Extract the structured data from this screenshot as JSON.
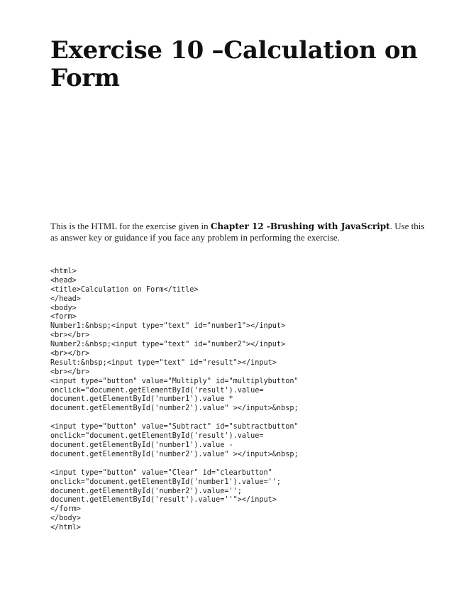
{
  "document": {
    "title": "Exercise 10 –Calculation on Form",
    "intro": {
      "before": "This is the HTML for the exercise given in ",
      "chapter": "Chapter 12 -Brushing with JavaScript",
      "after": ". Use this as answer key or guidance if you face any problem in performing the exercise."
    },
    "code_blocks": [
      {
        "lines": [
          "<html>",
          "<head>",
          "<title>Calculation on Form</title>",
          "</head>",
          "<body>",
          "<form>",
          "Number1:&nbsp;<input type=\"text\" id=\"number1\"></input>",
          "<br></br>",
          "Number2:&nbsp;<input type=\"text\" id=\"number2\"></input>",
          "<br></br>",
          "Result:&nbsp;<input type=\"text\" id=\"result\"></input>",
          "<br></br>",
          "<input type=\"button\" value=\"Multiply\" id=\"multiplybutton\"",
          "onclick=\"document.getElementById('result').value=",
          "document.getElementById('number1').value *",
          "document.getElementById('number2').value\" ></input>&nbsp;"
        ]
      },
      {
        "lines": [
          "<input type=\"button\" value=\"Subtract\" id=\"subtractbutton\"",
          "onclick=\"document.getElementById('result').value=",
          "document.getElementById('number1').value -",
          "document.getElementById('number2').value\" ></input>&nbsp;"
        ]
      },
      {
        "lines": [
          "<input type=\"button\" value=\"Clear\" id=\"clearbutton\"",
          "onclick=\"document.getElementById('number1').value='';",
          "document.getElementById('number2').value='';",
          "document.getElementById('result').value=''\"></input>",
          "</form>",
          "</body>",
          "</html>"
        ]
      }
    ]
  }
}
